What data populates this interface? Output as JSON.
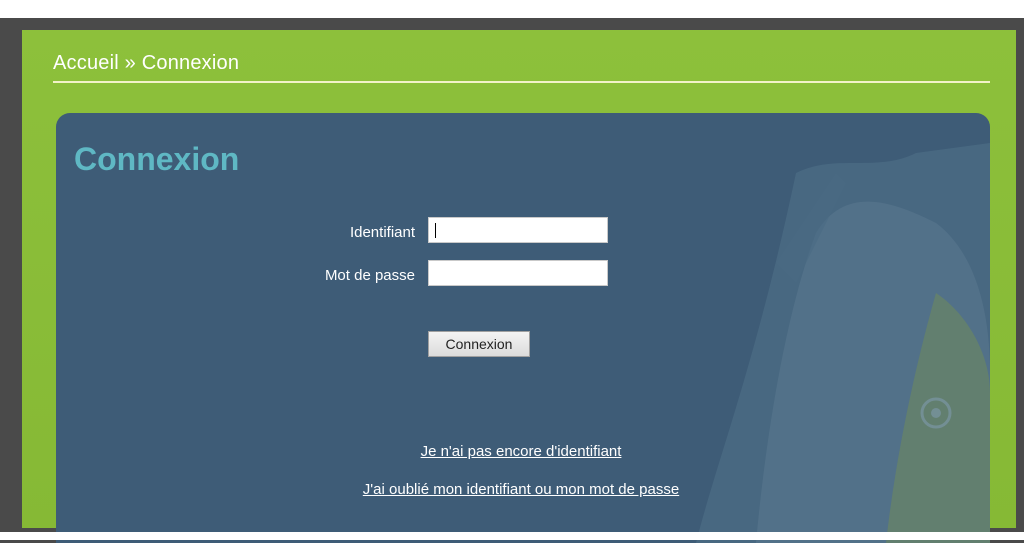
{
  "breadcrumb": {
    "home": "Accueil",
    "separator": "»",
    "current": "Connexion"
  },
  "panel": {
    "title": "Connexion"
  },
  "form": {
    "identifier_label": "Identifiant",
    "identifier_value": "",
    "password_label": "Mot de passe",
    "password_value": "",
    "submit_label": "Connexion"
  },
  "links": {
    "no_account": "Je n'ai pas encore d'identifiant",
    "forgot": "J'ai oublié mon identifiant ou mon mot de passe"
  },
  "colors": {
    "page_bg": "#4a4a4a",
    "green": "#8cbd3a",
    "panel": "#3e5c77",
    "title": "#5fb8c4"
  }
}
